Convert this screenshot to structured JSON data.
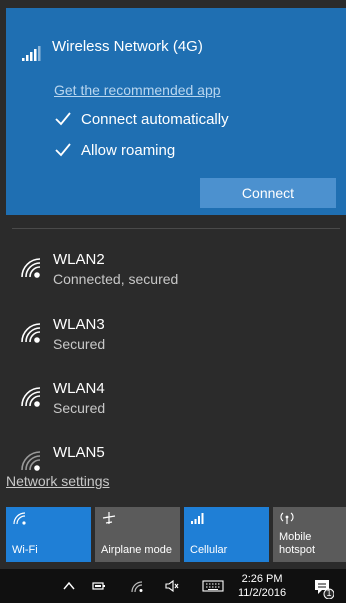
{
  "network_panel": {
    "title": "Wireless Network (4G)",
    "recommended_link": "Get the recommended app",
    "connect_automatically": "Connect automatically",
    "allow_roaming": "Allow roaming",
    "connect_label": "Connect"
  },
  "networks": [
    {
      "name": "WLAN2",
      "status": "Connected, secured"
    },
    {
      "name": "WLAN3",
      "status": "Secured"
    },
    {
      "name": "WLAN4",
      "status": "Secured"
    },
    {
      "name": "WLAN5",
      "status": ""
    }
  ],
  "network_settings": "Network settings",
  "quick_actions": [
    {
      "label": "Wi-Fi",
      "icon": "wifi-icon",
      "active": true
    },
    {
      "label": "Airplane mode",
      "icon": "airplane-icon",
      "active": false
    },
    {
      "label": "Cellular",
      "icon": "cellular-icon",
      "active": true
    },
    {
      "label": "Mobile hotspot",
      "icon": "hotspot-icon",
      "active": false
    }
  ],
  "taskbar": {
    "time": "2:26 PM",
    "date": "11/2/2016",
    "notification_count": "1"
  },
  "colors": {
    "accent": "#1f6fb2",
    "tile_active": "#1f7fd6",
    "background": "#2b2b2b"
  }
}
